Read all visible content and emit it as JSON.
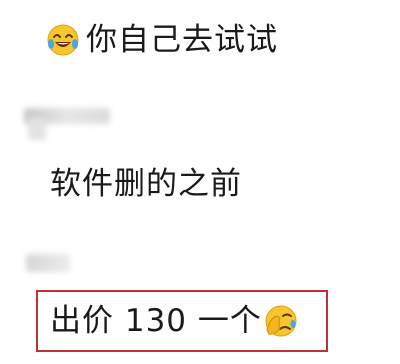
{
  "chat": {
    "messages": [
      {
        "emoji": "laughing-tears-emoji",
        "text": "你自己去试试"
      },
      {
        "text": "软件删的之前"
      },
      {
        "text": "出价 130 一个",
        "emoji": "facepalm-emoji"
      }
    ]
  },
  "colors": {
    "highlight_border": "#c0303a",
    "text": "#1a1a1a",
    "emoji_yellow": "#f7c52e"
  }
}
